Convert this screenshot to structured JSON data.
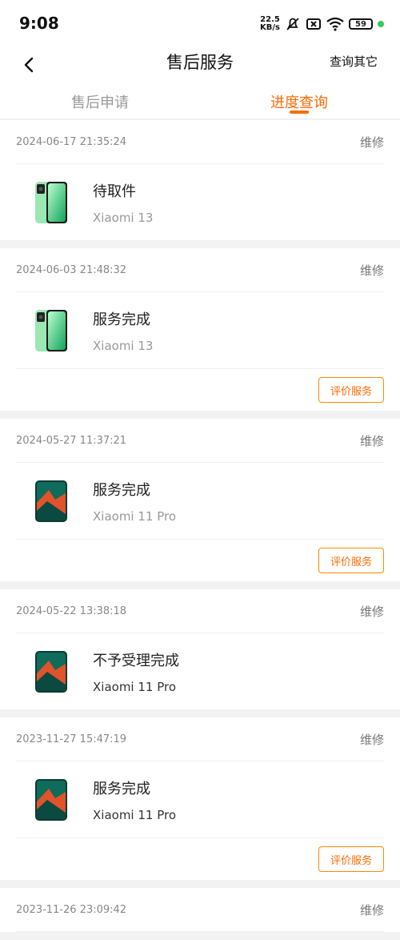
{
  "status_bar": {
    "time": "9:08",
    "net_speed_top": "22.5",
    "net_speed_bottom": "KB/s",
    "battery": "59"
  },
  "header": {
    "title": "售后服务",
    "more": "查询其它"
  },
  "tabs": [
    {
      "label": "售后申请",
      "active": false
    },
    {
      "label": "进度查询",
      "active": true
    }
  ],
  "colors": {
    "accent": "#ff6a00"
  },
  "orders": [
    {
      "date": "2024-06-17 21:35:24",
      "type": "维修",
      "status": "待取件",
      "model": "Xiaomi 13",
      "action": ""
    },
    {
      "date": "2024-06-03 21:48:32",
      "type": "维修",
      "status": "服务完成",
      "model": "Xiaomi 13",
      "action": "评价服务"
    },
    {
      "date": "2024-05-27 11:37:21",
      "type": "维修",
      "status": "服务完成",
      "model": "Xiaomi 11 Pro",
      "action": "评价服务"
    },
    {
      "date": "2024-05-22 13:38:18",
      "type": "维修",
      "status": "不予受理完成",
      "model": "Xiaomi 11 Pro",
      "action": ""
    },
    {
      "date": "2023-11-27 15:47:19",
      "type": "维修",
      "status": "服务完成",
      "model": "Xiaomi 11 Pro",
      "action": "评价服务"
    },
    {
      "date": "2023-11-26 23:09:42",
      "type": "维修",
      "status": "",
      "model": "",
      "action": ""
    }
  ]
}
